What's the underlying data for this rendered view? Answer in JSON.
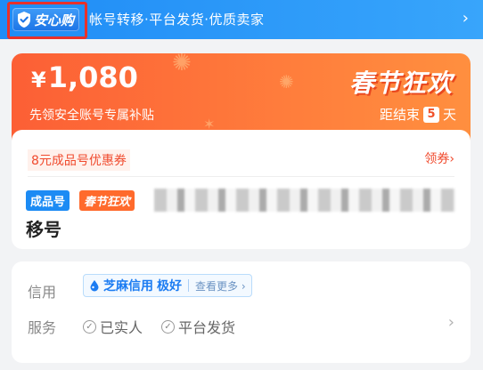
{
  "banner": {
    "badge_label": "安心购",
    "text": "帐号转移·平台发货·优质卖家",
    "chevron": "›"
  },
  "promo": {
    "currency": "¥",
    "amount": "1,080",
    "subtitle": "先领安全账号专属补贴",
    "festival_title": "春节狂欢",
    "countdown_prefix": "距结束",
    "countdown_days": "5",
    "countdown_unit": "天"
  },
  "product": {
    "coupon_text": "8元成品号优惠券",
    "claim_label": "领券",
    "claim_chevron": "›",
    "tag_finished": "成品号",
    "tag_festival": "春节狂欢",
    "title_tail": "移号"
  },
  "info": {
    "credit_label": "信用",
    "sesame_brand": "芝麻信用",
    "sesame_grade": "极好",
    "sesame_more": "查看更多 ›",
    "service_label": "服务",
    "services": [
      "已实人",
      "平台发货"
    ],
    "chevron": "›"
  },
  "colors": {
    "banner_blue": "#1f8cf6",
    "promo_orange": "#fc5f35",
    "accent_red": "#f04b2e",
    "tag_blue": "#1c8bf4",
    "tag_orange": "#ff6a2c"
  }
}
